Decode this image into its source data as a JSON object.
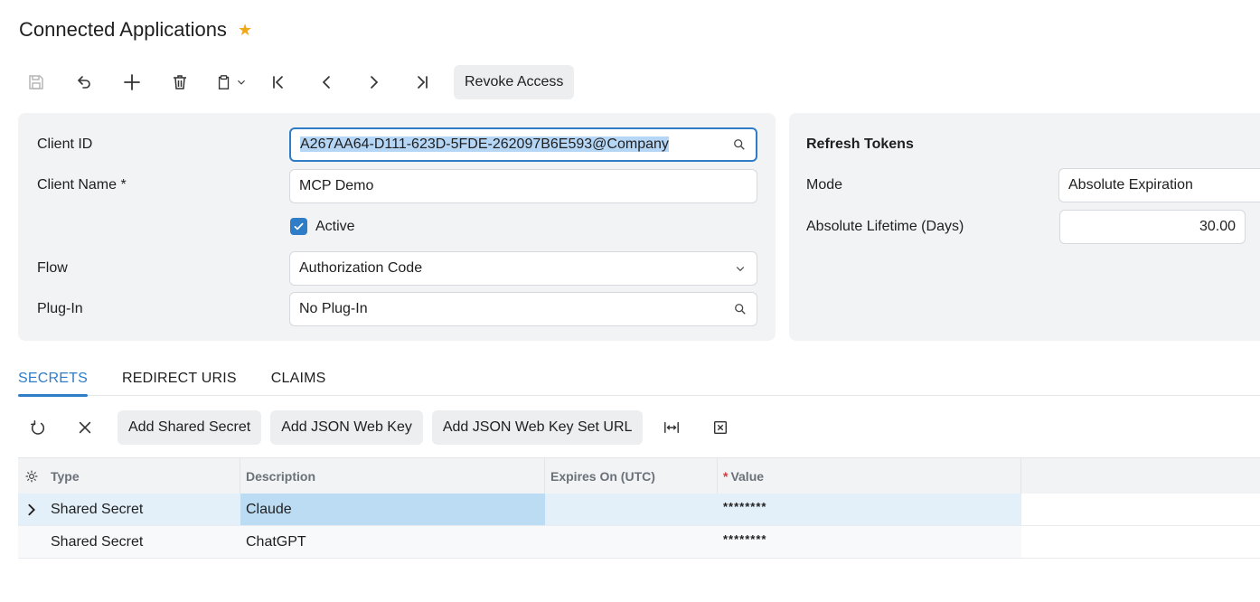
{
  "page": {
    "title": "Connected Applications"
  },
  "toolbar": {
    "revoke_label": "Revoke Access"
  },
  "form": {
    "client_id_label": "Client ID",
    "client_id_value": "A267AA64-D111-623D-5FDE-262097B6E593@Company",
    "client_name_label": "Client Name *",
    "client_name_value": "MCP Demo",
    "active_label": "Active",
    "flow_label": "Flow",
    "flow_value": "Authorization Code",
    "plugin_label": "Plug-In",
    "plugin_value": "No Plug-In"
  },
  "refresh": {
    "title": "Refresh Tokens",
    "mode_label": "Mode",
    "mode_value": "Absolute Expiration",
    "lifetime_label": "Absolute Lifetime (Days)",
    "lifetime_value": "30.00"
  },
  "tabs": [
    {
      "label": "SECRETS"
    },
    {
      "label": "REDIRECT URIS"
    },
    {
      "label": "CLAIMS"
    }
  ],
  "gridbar": {
    "add_shared_secret": "Add Shared Secret",
    "add_json_web_key": "Add JSON Web Key",
    "add_json_web_key_set_url": "Add JSON Web Key Set URL"
  },
  "grid": {
    "columns": {
      "type": "Type",
      "description": "Description",
      "expires": "Expires On (UTC)",
      "value": "Value"
    },
    "rows": [
      {
        "type": "Shared Secret",
        "description": "Claude",
        "expires": "",
        "value": "********"
      },
      {
        "type": "Shared Secret",
        "description": "ChatGPT",
        "expires": "",
        "value": "********"
      }
    ]
  },
  "colors": {
    "accent": "#2f7dc7",
    "star": "#f0a818",
    "required": "#d23b3b"
  }
}
